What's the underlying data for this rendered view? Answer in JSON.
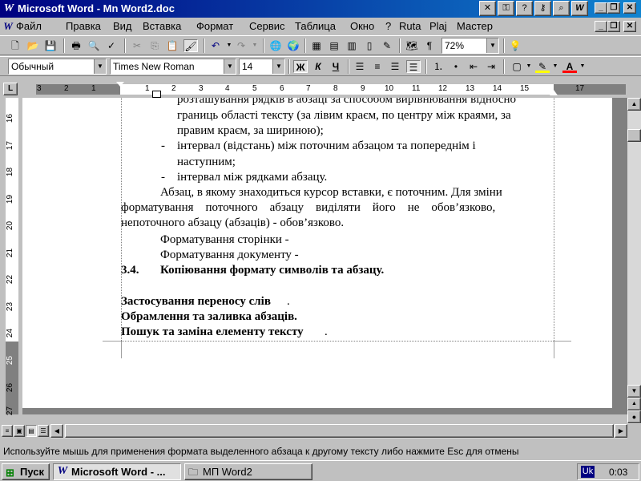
{
  "window": {
    "title": "Microsoft Word - Mn Word2.doc"
  },
  "menu": [
    "Файл",
    "Правка",
    "Вид",
    "Вставка",
    "Формат",
    "Сервис",
    "Таблица",
    "Окно",
    "?",
    "Ruta",
    "Plaj",
    "Мастер"
  ],
  "toolbar": {
    "zoom": "72%"
  },
  "format": {
    "style": "Обычный",
    "font": "Times New Roman",
    "size": "14",
    "bold": "Ж",
    "italic": "К",
    "underline": "Ч"
  },
  "ruler": {
    "h_labels": [
      "3",
      "2",
      "1",
      "1",
      "2",
      "3",
      "4",
      "5",
      "6",
      "7",
      "8",
      "9",
      "10",
      "11",
      "12",
      "13",
      "14",
      "15",
      "17"
    ],
    "v_labels": [
      "16",
      "17",
      "18",
      "19",
      "20",
      "21",
      "22",
      "23",
      "24",
      "25",
      "26",
      "27"
    ]
  },
  "document": {
    "lines": [
      "розташування рядків в абзаці за способом вирівнювання відносно",
      "границь області тексту (за лівим краєм, по центру між краями, за",
      "правим краєм, за шириною);",
      "інтервал (відстань) між поточним абзацом та попереднім і",
      "наступним;",
      "інтервал між рядками абзацу.",
      "Абзац, в якому знаходиться курсор вставки, є поточним. Для зміни",
      "форматування    поточного    абзацу    виділяти    його    не    обов’язково,",
      "непоточного абзацу (абзаців) - обов’язково.",
      "Форматування сторінки -",
      "Форматування документу -",
      "3.4.",
      "Копіювання формату символів та абзацу.",
      "Застосування переносу слів",
      "Обрамлення та заливка абзаців.",
      "Пошук та заміна елементу тексту",
      "."
    ],
    "dash": "-"
  },
  "status": {
    "text": "Используйте мышь для применения формата выделенного абзаца к другому тексту либо нажмите Esc для отмены"
  },
  "taskbar": {
    "start": "Пуск",
    "task1": "Microsoft Word - ...",
    "task2": "МП Word2",
    "lang": "Uk",
    "clock": "0:03"
  }
}
